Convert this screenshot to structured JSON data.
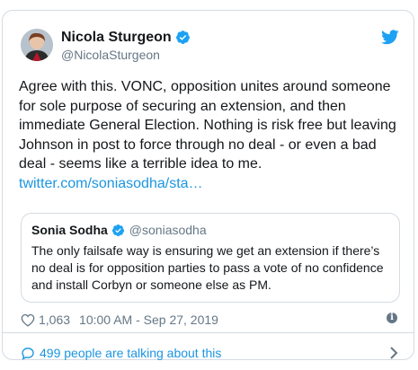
{
  "colors": {
    "link": "#1b95e0",
    "secondary_text": "#657786",
    "border": "#d4dbe1",
    "verified_blue": "#1da1f2"
  },
  "tweet": {
    "author_name": "Nicola Sturgeon",
    "author_handle": "@NicolaSturgeon",
    "body": "Agree with this. VONC, opposition unites around someone for sole purpose of securing an extension, and then immediate General Election. Nothing is risk free but leaving Johnson in post to force through no deal - or even a bad deal - seems like a terrible idea to me.",
    "link_text": "twitter.com/soniasodha/sta…",
    "likes": "1,063",
    "timestamp": "10:00 AM - Sep 27, 2019",
    "icons": {
      "verified": "verified-badge-icon",
      "brand": "twitter-bird-icon",
      "like": "heart-icon",
      "info": "info-icon",
      "reply": "speech-bubble-icon",
      "more": "chevron-right-icon"
    }
  },
  "quoted_tweet": {
    "author_name": "Sonia Sodha",
    "author_handle": "@soniasodha",
    "body": "The only failsafe way is ensuring we get an extension if there’s no deal is for opposition parties to pass a vote of no confidence and install Corbyn or someone else as PM."
  },
  "footer": {
    "conversation_text": "499 people are talking about this"
  }
}
